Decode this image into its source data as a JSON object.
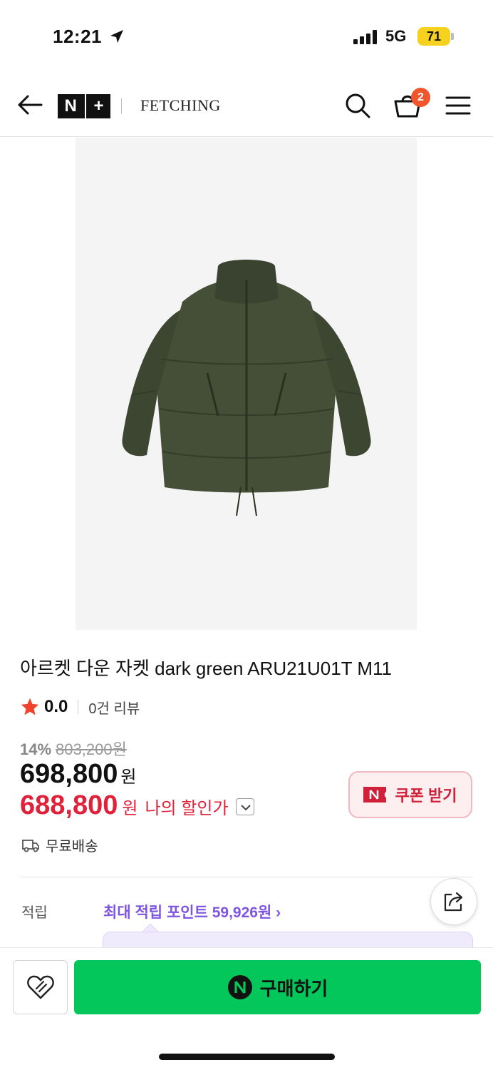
{
  "status_bar": {
    "time": "12:21",
    "network": "5G",
    "battery": "71"
  },
  "header": {
    "logo_left": "N",
    "logo_right": "+",
    "store_name": "FETCHING",
    "cart_count": "2"
  },
  "product": {
    "title": "아르켓 다운 자켓 dark green ARU21U01T M11",
    "rating": "0.0",
    "review_count": "0건 리뷰",
    "discount_rate": "14%",
    "original_price": "803,200원",
    "sale_price": "698,800",
    "sale_unit": "원",
    "my_price": "688,800",
    "my_unit": "원",
    "my_price_label": "나의 할인가",
    "shipping": "무료배송",
    "points_label": "적립",
    "points_link": "최대 적립 포인트 59,926원 ›"
  },
  "coupon": {
    "label": "쿠폰 받기"
  },
  "bottom_bar": {
    "buy_label": "구매하기"
  },
  "colors": {
    "accent_red": "#e0213a",
    "buy_green": "#03c75a",
    "points_purple": "#7e55e0",
    "badge_orange": "#f0552c",
    "star": "#f0452c"
  },
  "icons": [
    "location-arrow-icon",
    "signal-icon",
    "back-arrow-icon",
    "search-icon",
    "cart-icon",
    "menu-icon",
    "star-icon",
    "chevron-down-icon",
    "coupon-n-icon",
    "truck-icon",
    "share-icon",
    "heart-icon",
    "npay-icon"
  ]
}
